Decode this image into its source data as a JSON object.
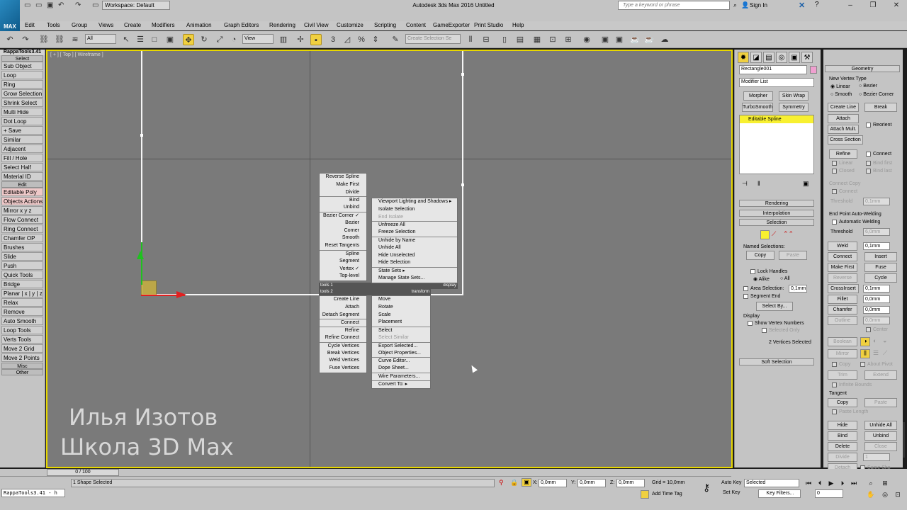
{
  "app": {
    "title": "Autodesk 3ds Max 2016    Untitled",
    "workspace": "Workspace: Default",
    "search_placeholder": "Type a keyword or phrase",
    "sign_in": "Sign In",
    "logo": "MAX"
  },
  "menu": [
    "Edit",
    "Tools",
    "Group",
    "Views",
    "Create",
    "Modifiers",
    "Animation",
    "Graph Editors",
    "Rendering",
    "Civil View",
    "Customize",
    "Scripting",
    "Content",
    "GameExporter",
    "Print Studio",
    "Help"
  ],
  "toolbar": {
    "filter_dropdown": "All",
    "refcoord_dropdown": "View",
    "selection_set_placeholder": "Create Selection Se"
  },
  "left_panel": {
    "title": "RappaTools3.41",
    "items": [
      {
        "type": "sect",
        "label": "Select"
      },
      {
        "type": "btn",
        "label": "Sub Object"
      },
      {
        "type": "btn",
        "label": "Loop"
      },
      {
        "type": "btn",
        "label": "Ring"
      },
      {
        "type": "btn",
        "label": "Grow Selection"
      },
      {
        "type": "btn",
        "label": "Shrink Select"
      },
      {
        "type": "btn",
        "label": "Multi Hide"
      },
      {
        "type": "btn",
        "label": "Dot Loop"
      },
      {
        "type": "btn",
        "label": "+ Save"
      },
      {
        "type": "btn",
        "label": "Similar"
      },
      {
        "type": "btn",
        "label": "Adjacent"
      },
      {
        "type": "btn",
        "label": "Fill / Hole"
      },
      {
        "type": "btn",
        "label": "Select Half"
      },
      {
        "type": "btn",
        "label": "Material ID"
      },
      {
        "type": "sect",
        "label": "Edit"
      },
      {
        "type": "btn",
        "label": "Editable Poly",
        "red": true
      },
      {
        "type": "btn",
        "label": "Objects Actions",
        "red": true
      },
      {
        "type": "btn",
        "label": "Mirror   x  y  z"
      },
      {
        "type": "btn",
        "label": "Flow Connect"
      },
      {
        "type": "btn",
        "label": "Ring Connect"
      },
      {
        "type": "btn",
        "label": "Chamfer OP"
      },
      {
        "type": "btn",
        "label": "Brushes"
      },
      {
        "type": "btn",
        "label": "Slide"
      },
      {
        "type": "btn",
        "label": "Push"
      },
      {
        "type": "btn",
        "label": "Quick Tools"
      },
      {
        "type": "btn",
        "label": "Bridge"
      },
      {
        "type": "btn",
        "label": "Planar | x | y | z"
      },
      {
        "type": "btn",
        "label": "Relax"
      },
      {
        "type": "btn",
        "label": "Remove"
      },
      {
        "type": "btn",
        "label": "Auto Smooth"
      },
      {
        "type": "btn",
        "label": "Loop Tools"
      },
      {
        "type": "btn",
        "label": "Verts Tools"
      },
      {
        "type": "btn",
        "label": "Move 2 Grid"
      },
      {
        "type": "btn",
        "label": "Move 2 Points"
      },
      {
        "type": "sect",
        "label": "Misc"
      },
      {
        "type": "sect",
        "label": "Other"
      }
    ]
  },
  "viewport": {
    "label": "[ + ] [ Top ] [ Wireframe ]",
    "watermark_line1": "Илья Изотов",
    "watermark_line2": "Школа 3D Max"
  },
  "quad_menu": {
    "tools1_items": [
      {
        "label": "Reverse Spline"
      },
      {
        "label": "Make First"
      },
      {
        "label": "Divide"
      },
      {
        "label": "Bind",
        "sep": true
      },
      {
        "label": "Unbind"
      },
      {
        "label": "Bezier Corner ✓",
        "sep": true
      },
      {
        "label": "Bezier"
      },
      {
        "label": "Corner"
      },
      {
        "label": "Smooth"
      },
      {
        "label": "Reset Tangents"
      },
      {
        "label": "Spline",
        "sep": true
      },
      {
        "label": "Segment"
      },
      {
        "label": "Vertex ✓"
      },
      {
        "label": "Top-level"
      }
    ],
    "tools1_label": "tools 1",
    "tools2_label": "tools 2",
    "tools2_items": [
      {
        "label": "Create Line"
      },
      {
        "label": "Attach"
      },
      {
        "label": "Detach Segment"
      },
      {
        "label": "Connect",
        "sep": true
      },
      {
        "label": "Refine",
        "sep": true
      },
      {
        "label": "Refine Connect"
      },
      {
        "label": "Cycle Vertices",
        "sep": true
      },
      {
        "label": "Break Vertices"
      },
      {
        "label": "Weld Vertices"
      },
      {
        "label": "Fuse Vertices"
      }
    ],
    "display_label": "display",
    "display_items": [
      {
        "label": "Viewport Lighting and Shadows ▸"
      },
      {
        "label": "Isolate Selection"
      },
      {
        "label": "End Isolate",
        "dis": true
      },
      {
        "label": "Unfreeze All",
        "sep": true
      },
      {
        "label": "Freeze Selection"
      },
      {
        "label": "Unhide by Name",
        "sep": true
      },
      {
        "label": "Unhide All"
      },
      {
        "label": "Hide Unselected"
      },
      {
        "label": "Hide Selection"
      },
      {
        "label": "State Sets ▸",
        "sep": true
      },
      {
        "label": "Manage State Sets..."
      }
    ],
    "transform_label": "transform",
    "transform_items": [
      {
        "label": "Move"
      },
      {
        "label": "Rotate"
      },
      {
        "label": "Scale"
      },
      {
        "label": "Placement"
      },
      {
        "label": "Select",
        "sep": true
      },
      {
        "label": "Select Similar",
        "dis": true
      },
      {
        "label": "Export Selected...",
        "sep": true
      },
      {
        "label": "Object Properties..."
      },
      {
        "label": "Curve Editor...",
        "sep": true
      },
      {
        "label": "Dope Sheet..."
      },
      {
        "label": "Wire Parameters...",
        "sep": true
      },
      {
        "label": "Convert To: ▸",
        "sep": true
      }
    ]
  },
  "cmd_panel": {
    "object_name": "Rectangle001",
    "modifier_list": "Modifier List",
    "quick_mods": [
      "Morpher",
      "Skin Wrap",
      "TurboSmooth",
      "Symmetry"
    ],
    "stack_item": "Editable Spline",
    "rollouts": [
      "Rendering",
      "Interpolation",
      "Selection",
      "Soft Selection"
    ],
    "named_selections": "Named Selections:",
    "copy": "Copy",
    "paste": "Paste",
    "lock_handles": "Lock Handles",
    "alike": "Alike",
    "all": "All",
    "area_selection": "Area Selection:",
    "area_value": "0,1mm",
    "segment_end": "Segment End",
    "select_by": "Select By...",
    "display": "Display",
    "show_vertex_numbers": "Show Vertex Numbers",
    "selected_only": "Selected Only",
    "vertices_selected": "2 Vertices Selected"
  },
  "geometry": {
    "title": "Geometry",
    "new_vertex_type": "New Vertex Type",
    "linear": "Linear",
    "bezier": "Bezier",
    "smooth": "Smooth",
    "bezier_corner": "Bezier Corner",
    "create_line": "Create Line",
    "break": "Break",
    "attach": "Attach",
    "reorient": "Reorient",
    "attach_mult": "Attach Mult.",
    "cross_section": "Cross Section",
    "refine": "Refine",
    "connect": "Connect",
    "linear_chk": "Linear",
    "bind_first": "Bind first",
    "closed": "Closed",
    "bind_last": "Bind last",
    "connect_copy": "Connect Copy",
    "connect2": "Connect",
    "threshold": "Threshold",
    "threshold_val": "0,1mm",
    "end_point_auto_welding": "End Point Auto-Welding",
    "automatic_welding": "Automatic Welding",
    "threshold2_val": "6,0mm",
    "weld": "Weld",
    "weld_val": "0,1mm",
    "connect_btn": "Connect",
    "insert": "Insert",
    "make_first": "Make First",
    "fuse": "Fuse",
    "reverse": "Reverse",
    "cycle": "Cycle",
    "crossinsert": "CrossInsert",
    "crossinsert_val": "0,1mm",
    "fillet": "Fillet",
    "fillet_val": "0,0mm",
    "chamfer": "Chamfer",
    "chamfer_val": "0,0mm",
    "outline": "Outline",
    "outline_val": "0,0mm",
    "center": "Center",
    "boolean": "Boolean",
    "mirror": "Mirror",
    "copy": "Copy",
    "about_pivot": "About Pivot",
    "trim": "Trim",
    "extend": "Extend",
    "infinite_bounds": "Infinite Bounds",
    "tangent": "Tangent",
    "copy2": "Copy",
    "paste": "Paste",
    "paste_length": "Paste Length",
    "hide": "Hide",
    "unhide_all": "Unhide All",
    "bind": "Bind",
    "unbind": "Unbind",
    "delete": "Delete",
    "close": "Close",
    "divide": "Divide",
    "divide_val": "1",
    "detach": "Detach",
    "same_shp": "Same Shp"
  },
  "status": {
    "maxscript": "RappaTools3.41 - h",
    "time": "0 / 100",
    "selected": "1 Shape Selected",
    "x": "0,0mm",
    "y": "0,0mm",
    "z": "0,0mm",
    "grid": "Grid = 10,0mm",
    "add_time_tag": "Add Time Tag",
    "auto_key": "Auto Key",
    "set_key": "Set Key",
    "selected_dropdown": "Selected",
    "key_filters": "Key Filters...",
    "frame": "0"
  }
}
